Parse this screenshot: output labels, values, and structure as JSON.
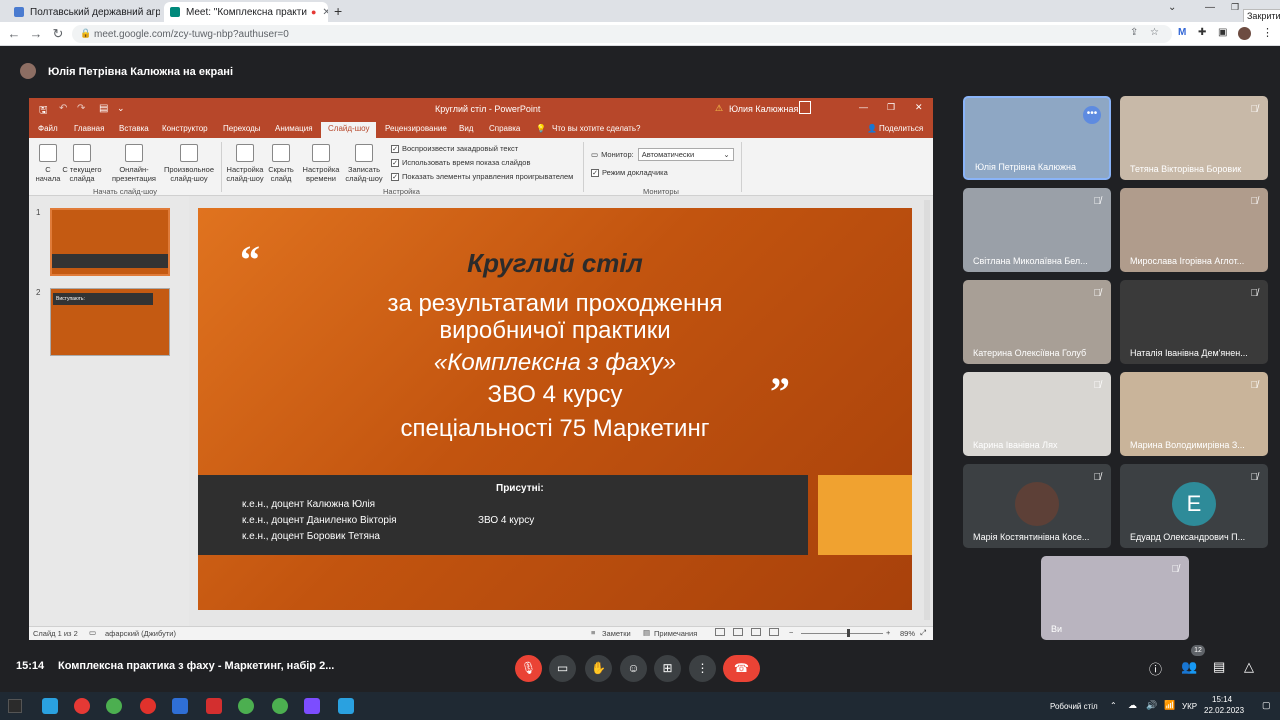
{
  "browser": {
    "tabs": [
      {
        "label": "Полтавський державний аграр"
      },
      {
        "label": "Meet: \"Комплексна практи"
      }
    ],
    "url": "meet.google.com/zcy-tuwg-nbp?authuser=0",
    "tooltip": "Закрити"
  },
  "meet": {
    "presenter_banner": "Юлія Петрівна Калюжна на екрані",
    "time": "15:14",
    "meeting_title": "Комплексна практика з фаху - Маркетинг, набір 2...",
    "participant_count": "12",
    "participants": [
      {
        "name": "Юлія Петрівна Калюжна"
      },
      {
        "name": "Тетяна Вікторівна Боровик"
      },
      {
        "name": "Світлана Миколаївна Бел..."
      },
      {
        "name": "Мирослава Ігорівна Аглот..."
      },
      {
        "name": "Катерина Олексіївна Голуб"
      },
      {
        "name": "Наталія Іванівна Дем'янен..."
      },
      {
        "name": "Карина Іванівна Лях"
      },
      {
        "name": "Марина Володимирівна З..."
      },
      {
        "name": "Марія Костянтинівна Косе..."
      },
      {
        "name": "Едуард Олександрович П..."
      },
      {
        "name": "Ви"
      }
    ],
    "avatar_letter": "E"
  },
  "ppt": {
    "window_title": "Круглий стіл  -  PowerPoint",
    "user": "Юлия Калюжная",
    "share": "Поделиться",
    "tell_me": "Что вы хотите сделать?",
    "tabs": [
      "Файл",
      "Главная",
      "Вставка",
      "Конструктор",
      "Переходы",
      "Анимация",
      "Слайд-шоу",
      "Рецензирование",
      "Вид",
      "Справка"
    ],
    "ribbon": {
      "from_start": "С\nначала",
      "from_current": "С текущего\nслайда",
      "online": "Онлайн-\nпрезентация",
      "custom": "Произвольное\nслайд-шоу",
      "group1": "Начать слайд-шоу",
      "setup": "Настройка\nслайд-шоу",
      "hide": "Скрыть\nслайд",
      "rehearse": "Настройка\nвремени",
      "record": "Записать\nслайд-шоу",
      "chk1": "Воспроизвести закадровый текст",
      "chk2": "Использовать время показа слайдов",
      "chk3": "Показать элементы управления проигрывателем",
      "group2": "Настройка",
      "monitor_label": "Монитор:",
      "monitor_value": "Автоматически",
      "presenter_view": "Режим докладчика",
      "group3": "Мониторы"
    },
    "slide": {
      "title": "Круглий стіл",
      "line1": "за результатами проходження",
      "line2": "виробничої практики",
      "line3": "«Комплексна з фаху»",
      "line4": "ЗВО 4 курсу",
      "line5": "спеціальності 75 Маркетинг",
      "present": "Присутні:",
      "att1": "к.е.н., доцент Калюжна Юлія",
      "att2": "к.е.н., доцент Даниленко Вікторія",
      "att3": "к.е.н., доцент Боровик Тетяна",
      "course": "ЗВО 4 курсу",
      "quote_open": "“",
      "quote_close": "”"
    },
    "thumb_nums": [
      "1",
      "2"
    ],
    "thumb2_title": "Виступають:",
    "status": {
      "slide_of": "Слайд 1 из 2",
      "lang": "афарский (Джибути)",
      "notes": "Заметки",
      "comments": "Примечания",
      "zoom": "89%"
    }
  },
  "taskbar": {
    "desktop": "Робочий стіл",
    "lang": "УКР",
    "time": "15:14",
    "date": "22.02.2023"
  }
}
